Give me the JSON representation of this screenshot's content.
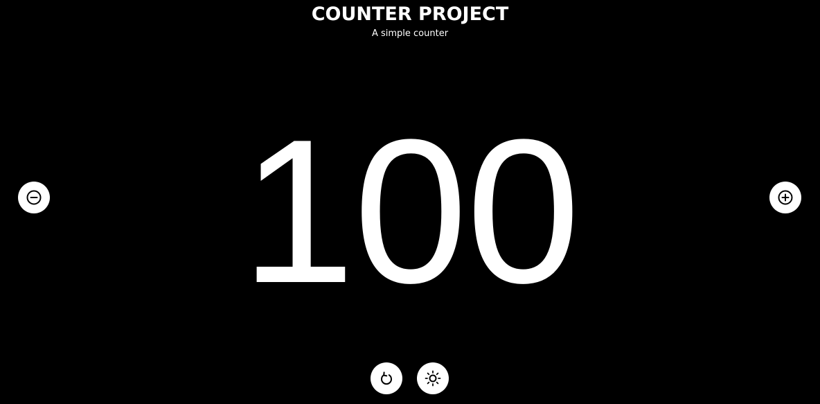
{
  "header": {
    "title": "COUNTER PROJECT",
    "subtitle": "A simple counter"
  },
  "counter": {
    "value": "100"
  },
  "controls": {
    "decrement_icon": "minus-circle-icon",
    "increment_icon": "plus-circle-icon",
    "reset_icon": "rotate-ccw-icon",
    "theme_icon": "sun-icon"
  },
  "colors": {
    "background": "#000000",
    "foreground": "#ffffff"
  }
}
